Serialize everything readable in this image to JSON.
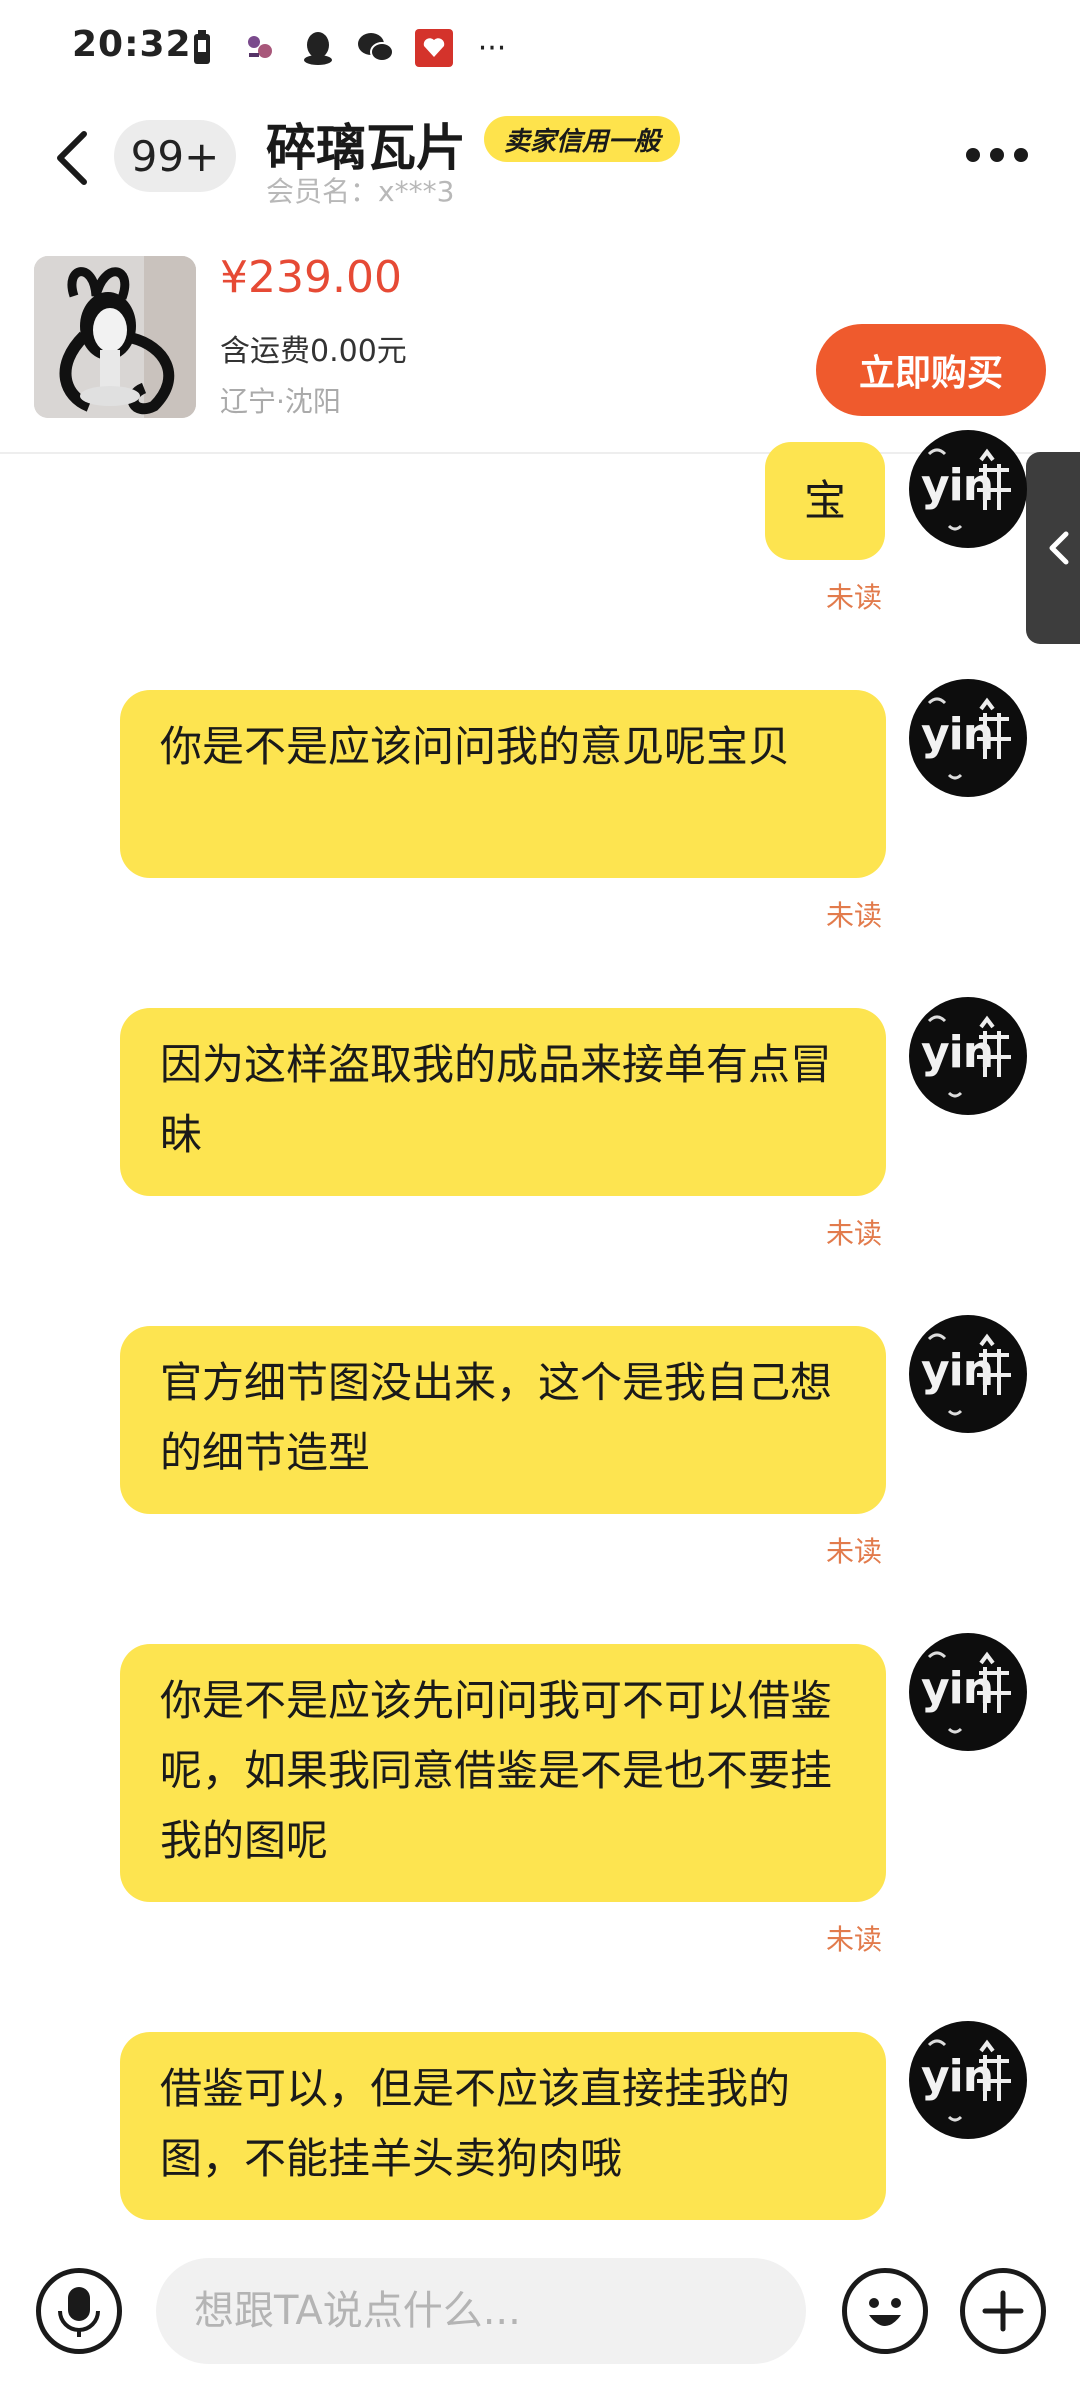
{
  "status_bar": {
    "time": "20:32",
    "more": "···"
  },
  "header": {
    "unread_count": "99+",
    "seller_name": "碎璃瓦片",
    "credit_tag": "卖家信用一般",
    "member_name": "会员名：x***3"
  },
  "product": {
    "price": "¥239.00",
    "shipping": "含运费0.00元",
    "location": "辽宁·沈阳",
    "buy_label": "立即购买"
  },
  "avatar_text": "yin",
  "messages": [
    {
      "text": "宝",
      "status": "未读"
    },
    {
      "text": "你是不是应该问问我的意见呢宝贝",
      "status": "未读"
    },
    {
      "text": "因为这样盗取我的成品来接单有点冒昧",
      "status": "未读"
    },
    {
      "text": "官方细节图没出来，这个是我自己想的细节造型",
      "status": "未读"
    },
    {
      "text": "你是不是应该先问问我可不可以借鉴呢，如果我同意借鉴是不是也不要挂我的图呢",
      "status": "未读"
    },
    {
      "text": "借鉴可以，但是不应该直接挂我的图，不能挂羊头卖狗肉哦",
      "status": ""
    }
  ],
  "composer": {
    "placeholder": "想跟TA说点什么..."
  },
  "colors": {
    "bubble": "#fde450",
    "price": "#e64a35",
    "buy_button": "#ef5a2d",
    "unread": "#e27b4c"
  },
  "icons": [
    "back-icon",
    "more-icon",
    "mic-icon",
    "emoji-icon",
    "plus-icon",
    "side-tab-chevron-icon"
  ]
}
